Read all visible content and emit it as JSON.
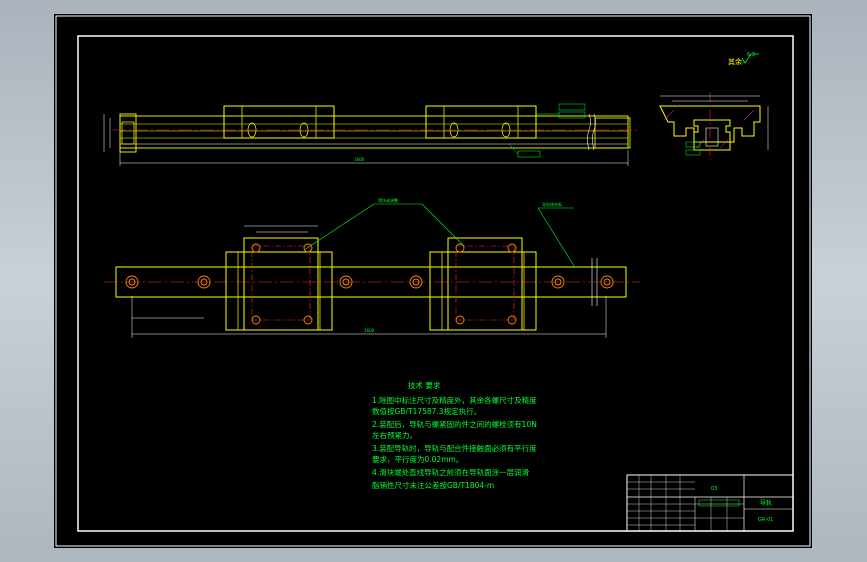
{
  "colors": {
    "background": "#000000",
    "outer_chrome": "#b9c1c8",
    "frame": "#ffffff",
    "rail": "#ffff00",
    "annotation": "#00ff33",
    "centerline": "#ff2a2a",
    "holes": "#ff8800"
  },
  "drawing": {
    "roughness_note": "其余",
    "roughness_symbol": "6.3",
    "callout_left": "滑块或调整",
    "callout_right": "导轨线夹板",
    "dim_side_length": "1600",
    "dim_plan_length": "1600"
  },
  "technical_requirements": {
    "title": "技术 要求",
    "lines": [
      "1.除图中标注尺寸及精度外，其余各螺尺寸及精度",
      "  数值按GB/T17587.3规定执行。",
      "2.装配后，导轨与螺紧固的件之间的螺栓须有10N",
      "  左右预紧力。",
      "3.装配导轨时，导轨与配合件接触面必须有平行度",
      "  要求，平行度为0.02mm。",
      "4.滑块端处直线导轨之前须在导轨面涂一层润滑",
      "脂销性尺寸未注公差按GB/T1804-m"
    ]
  },
  "title_block": {
    "name": "导轨",
    "code": "03",
    "sheet": "GR-01"
  }
}
